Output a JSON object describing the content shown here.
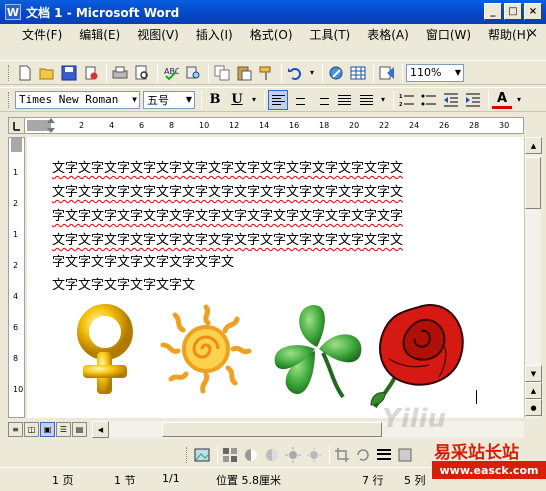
{
  "window": {
    "title": "文档 1 - Microsoft Word",
    "icon_letter": "W"
  },
  "window_buttons": [
    "_",
    "□",
    "×"
  ],
  "menu": {
    "items": [
      "文件(F)",
      "编辑(E)",
      "视图(V)",
      "插入(I)",
      "格式(O)",
      "工具(T)",
      "表格(A)",
      "窗口(W)",
      "帮助(H)"
    ],
    "help_arrow": "▾",
    "close": "×"
  },
  "toolbar_standard": {
    "zoom": "110%",
    "icons": [
      "new-doc-icon",
      "open-folder-icon",
      "save-icon",
      "permission-icon",
      "print-icon",
      "print-preview-icon",
      "spelling-icon",
      "research-icon",
      "copy-icon",
      "paste-icon",
      "format-painter-icon",
      "undo-icon",
      "hyperlink-icon",
      "table-icon",
      "document-map-icon"
    ]
  },
  "toolbar_format": {
    "font": "Times New Roman",
    "size": "五号",
    "bold": "B",
    "underline": "U",
    "font_color_letter": "A",
    "alignment": "left"
  },
  "ruler": {
    "top_numbers": [
      "2",
      "4",
      "6",
      "8",
      "10",
      "12",
      "14",
      "16",
      "18",
      "20",
      "22",
      "24",
      "26",
      "28",
      "30"
    ],
    "left_numbers": [
      "1",
      "2",
      "1",
      "2",
      "4",
      "6",
      "8",
      "10"
    ]
  },
  "document": {
    "lines": [
      "文字文字文字文字文字文字文字文字文字文字文字文字文字文",
      "文字文字文字文字文字文字文字文字文字文字文字文字文字文",
      "字文字文字文字文字文字文字文字文字文字文字文字文字文字",
      "文字文字文字文字文字文字文字文字文字文字文字文字文字文",
      "字文字文字文字文字文字文字文",
      "文字文字文字文字文字文"
    ],
    "cliparts": [
      "female-symbol-icon",
      "sun-icon",
      "clover-icon",
      "rose-icon"
    ]
  },
  "statusbar": {
    "page": "1 页",
    "section": "1 节",
    "pages": "1/1",
    "position": "位置 5.8厘米",
    "line": "7 行",
    "col": "5 列"
  },
  "watermark": {
    "cn": "易采站长站",
    "url": "www.easck.com",
    "faint": "Yiliu"
  },
  "colors": {
    "titlebar": "#0a5ee0",
    "squiggle": "#e00000",
    "chrome": "#ece9d8",
    "watermark_red": "#d81e06"
  }
}
